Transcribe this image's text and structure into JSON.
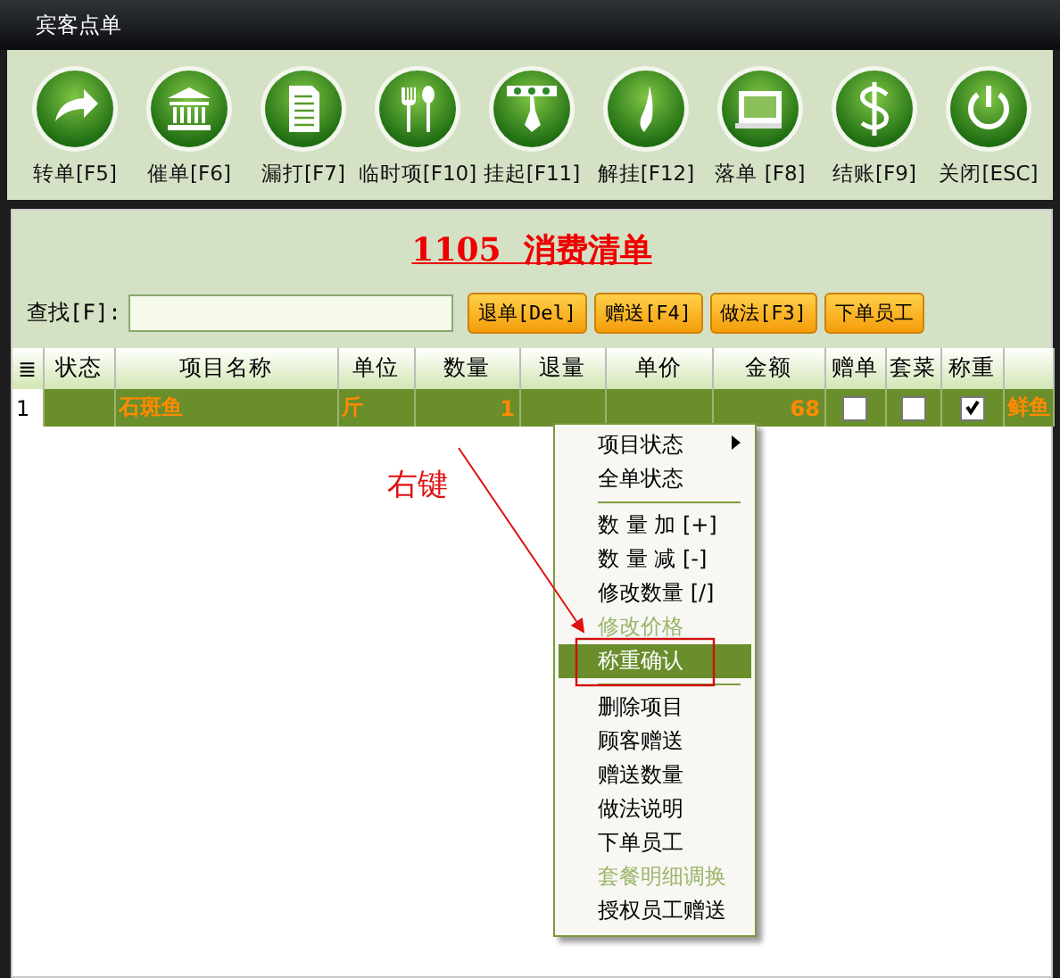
{
  "window": {
    "title": "宾客点单"
  },
  "toolbar": [
    {
      "label": "转单[F5]"
    },
    {
      "label": "催单[F6]"
    },
    {
      "label": "漏打[F7]"
    },
    {
      "label": "临时项[F10]"
    },
    {
      "label": "挂起[F11]"
    },
    {
      "label": "解挂[F12]"
    },
    {
      "label": "落单 [F8]"
    },
    {
      "label": "结账[F9]"
    },
    {
      "label": "关闭[ESC]"
    }
  ],
  "heading": "1105  消费清单",
  "search": {
    "label": "查找[F]:"
  },
  "actions": [
    "退单[Del]",
    "赠送[F4]",
    "做法[F3]",
    "下单员工"
  ],
  "table": {
    "columns": [
      "≣",
      "状态",
      "项目名称",
      "单位",
      "数量",
      "退量",
      "单价",
      "金额",
      "赠单",
      "套菜",
      "称重",
      null
    ],
    "rows": [
      {
        "selected": true,
        "cells": [
          {
            "kind": "text",
            "text": "1"
          },
          {
            "kind": "blank"
          },
          {
            "kind": "text",
            "text": "石斑鱼"
          },
          {
            "kind": "text",
            "text": "斤"
          },
          {
            "kind": "text",
            "text": "1"
          },
          {
            "kind": "blank"
          },
          {
            "kind": "blank"
          },
          {
            "kind": "text",
            "text": "68"
          },
          {
            "kind": "check",
            "checked": false
          },
          {
            "kind": "check",
            "checked": false
          },
          {
            "kind": "check",
            "checked": true
          },
          {
            "kind": "text",
            "text": "鲜鱼"
          }
        ]
      }
    ]
  },
  "annotation": {
    "text": "右键"
  },
  "context_menu": {
    "items": [
      {
        "kind": "item",
        "label": "项目状态",
        "submenu": true,
        "disabled": false,
        "selected": false
      },
      {
        "kind": "item",
        "label": "全单状态",
        "submenu": false,
        "disabled": false,
        "selected": false
      },
      {
        "kind": "separator"
      },
      {
        "kind": "item",
        "label": "数 量 加 [+]",
        "submenu": false,
        "disabled": false,
        "selected": false
      },
      {
        "kind": "item",
        "label": "数 量 减 [-]",
        "submenu": false,
        "disabled": false,
        "selected": false
      },
      {
        "kind": "item",
        "label": "修改数量 [/]",
        "submenu": false,
        "disabled": false,
        "selected": false
      },
      {
        "kind": "item",
        "label": "修改价格",
        "submenu": false,
        "disabled": true,
        "selected": false
      },
      {
        "kind": "item",
        "label": "称重确认",
        "submenu": false,
        "disabled": false,
        "selected": true
      },
      {
        "kind": "separator"
      },
      {
        "kind": "item",
        "label": "删除项目",
        "submenu": false,
        "disabled": false,
        "selected": false
      },
      {
        "kind": "item",
        "label": "顾客赠送",
        "submenu": false,
        "disabled": false,
        "selected": false
      },
      {
        "kind": "item",
        "label": "赠送数量",
        "submenu": false,
        "disabled": false,
        "selected": false
      },
      {
        "kind": "item",
        "label": "做法说明",
        "submenu": false,
        "disabled": false,
        "selected": false
      },
      {
        "kind": "item",
        "label": "下单员工",
        "submenu": false,
        "disabled": false,
        "selected": false
      },
      {
        "kind": "item",
        "label": "套餐明细调换",
        "submenu": false,
        "disabled": true,
        "selected": false
      },
      {
        "kind": "item",
        "label": "授权员工赠送",
        "submenu": false,
        "disabled": false,
        "selected": false
      }
    ]
  }
}
